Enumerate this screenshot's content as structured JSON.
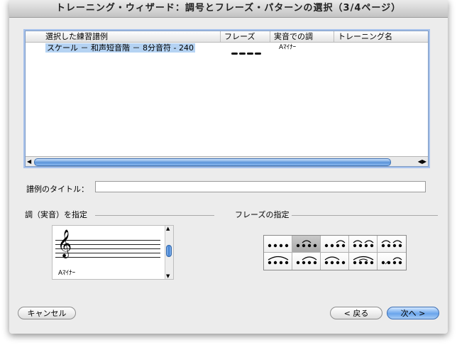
{
  "window": {
    "title": "トレーニング・ウィザード：調号とフレーズ・パターンの選択（3/4ページ）"
  },
  "table": {
    "columns": [
      "選択した練習譜例",
      "フレーズ",
      "実音での調",
      "トレーニング名"
    ],
    "rows": [
      {
        "example": "スケール － 和声短音階 － 8分音符 - 240",
        "key": "Aﾏｲﾅｰ",
        "training_name": ""
      }
    ]
  },
  "title_field": {
    "label": "譜例のタイトル：",
    "value": ""
  },
  "key_section": {
    "label": "調（実音）を指定",
    "selected_key": "Aﾏｲﾅｰ"
  },
  "phrase_section": {
    "label": "フレーズの指定",
    "selected_index": 1
  },
  "buttons": {
    "cancel": "キャンセル",
    "back": "< 戻る",
    "next": "次へ >"
  },
  "colors": {
    "selection": "#b5d3f3",
    "accent": "#6aa5ec"
  }
}
